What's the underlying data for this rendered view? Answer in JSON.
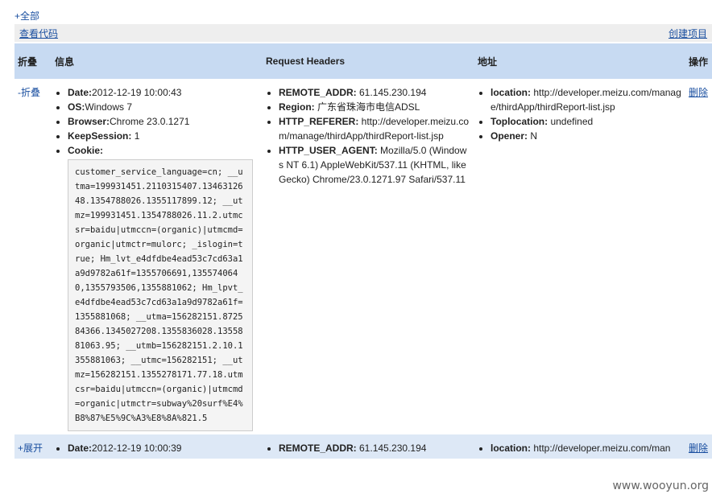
{
  "top_link": "+全部",
  "toolbar": {
    "view_code": "查看代码",
    "create_project": "创建项目"
  },
  "columns": {
    "fold": "折叠",
    "info": "信息",
    "headers": "Request Headers",
    "address": "地址",
    "action": "操作"
  },
  "rows": [
    {
      "toggle": "-折叠",
      "info": [
        {
          "label": "Date:",
          "value": "2012-12-19 10:00:43"
        },
        {
          "label": "OS:",
          "value": "Windows 7"
        },
        {
          "label": "Browser:",
          "value": "Chrome 23.0.1271"
        },
        {
          "label": "KeepSession:",
          "value": " 1"
        },
        {
          "label": "Cookie:",
          "value": ""
        }
      ],
      "cookie": "customer_service_language=cn; __utma=199931451.2110315407.1346312648.1354788026.1355117899.12; __utmz=199931451.1354788026.11.2.utmcsr=baidu|utmccn=(organic)|utmcmd=organic|utmctr=mulorc; _islogin=true; Hm_lvt_e4dfdbe4ead53c7cd63a1a9d9782a61f=1355706691,1355740640,1355793506,1355881062; Hm_lpvt_e4dfdbe4ead53c7cd63a1a9d9782a61f=1355881068; __utma=156282151.872584366.1345027208.1355836028.1355881063.95; __utmb=156282151.2.10.1355881063; __utmc=156282151; __utmz=156282151.1355278171.77.18.utmcsr=baidu|utmccn=(organic)|utmcmd=organic|utmctr=subway%20surf%E4%B8%87%E5%9C%A3%E8%8A%821.5",
      "headers": [
        {
          "label": "REMOTE_ADDR:",
          "value": " 61.145.230.194"
        },
        {
          "label": "Region:",
          "value": " 广东省珠海市电信ADSL"
        },
        {
          "label": "HTTP_REFERER:",
          "value": " http://developer.meizu.com/manage/thirdApp/thirdReport-list.jsp"
        },
        {
          "label": "HTTP_USER_AGENT:",
          "value": " Mozilla/5.0 (Windows NT 6.1) AppleWebKit/537.11 (KHTML, like Gecko) Chrome/23.0.1271.97 Safari/537.11"
        }
      ],
      "address": [
        {
          "label": "location:",
          "value": " http://developer.meizu.com/manage/thirdApp/thirdReport-list.jsp"
        },
        {
          "label": "Toplocation:",
          "value": " undefined"
        },
        {
          "label": "Opener:",
          "value": " N"
        }
      ],
      "action": "删除"
    },
    {
      "toggle": "+展开",
      "info": [
        {
          "label": "Date:",
          "value": "2012-12-19 10:00:39"
        }
      ],
      "headers": [
        {
          "label": "REMOTE_ADDR:",
          "value": " 61.145.230.194"
        }
      ],
      "address": [
        {
          "label": "location:",
          "value": " http://developer.meizu.com/man"
        }
      ],
      "action": "删除"
    }
  ],
  "watermark": "www.wooyun.org"
}
